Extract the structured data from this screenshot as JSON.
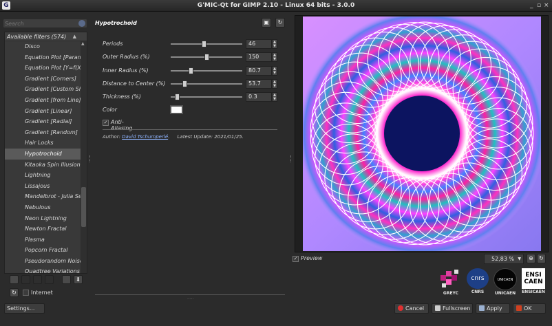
{
  "window": {
    "title": "G'MIC-Qt for GIMP 2.10 - Linux 64 bits - 3.0.0",
    "controls": "_ ▫ ×"
  },
  "search": {
    "placeholder": "Search"
  },
  "filters": {
    "header": "Available filters (574)",
    "items": [
      "Disco",
      "Equation Plot [Parametric]",
      "Equation Plot [Y=f(X)]",
      "Gradient [Corners]",
      "Gradient [Custom Shape]",
      "Gradient [from Line]",
      "Gradient [Linear]",
      "Gradient [Radial]",
      "Gradient [Random]",
      "Hair Locks",
      "Hypotrochoid",
      "Kitaoka Spin Illusion",
      "Lightning",
      "Lissajous",
      "Mandelbrot - Julia Sets",
      "Nebulous",
      "Neon Lightning",
      "Newton Fractal",
      "Plasma",
      "Popcorn Fractal",
      "Pseudorandom Noise",
      "Quadtree Variations"
    ],
    "selected_index": 10
  },
  "internet": {
    "label": "Internet",
    "checked": false
  },
  "settings_label": "Settings...",
  "filter": {
    "title": "Hypotrochoid",
    "params": [
      {
        "label": "Periods",
        "value": "46",
        "fraction": 0.46
      },
      {
        "label": "Outer Radius (%)",
        "value": "150",
        "fraction": 0.5
      },
      {
        "label": "Inner Radius (%)",
        "value": "80.7",
        "fraction": 0.27
      },
      {
        "label": "Distance to Center (%)",
        "value": "53.7",
        "fraction": 0.18
      },
      {
        "label": "Thickness (%)",
        "value": "0.3",
        "fraction": 0.06
      }
    ],
    "color_label": "Color",
    "color_value": "#ffffff",
    "antialias_label": "Anti-Aliasing",
    "antialias_checked": true,
    "author_prefix": "Author:",
    "author_name": "David Tschumperlé",
    "author_suffix": ".",
    "update_text": "Latest Update: 2021/01/25."
  },
  "preview": {
    "label": "Preview",
    "checked": true,
    "zoom": "52,83 %",
    "curve_periods": 46
  },
  "logos": [
    {
      "caption": "GREYC",
      "text": ""
    },
    {
      "caption": "CNRS",
      "text": "cnrs"
    },
    {
      "caption": "UNICAEN",
      "text": "UNICAEN"
    },
    {
      "caption": "ENSICAEN",
      "text": "ENSI CAEN"
    }
  ],
  "buttons": {
    "cancel": "Cancel",
    "fullscreen": "Fullscreen",
    "apply": "Apply",
    "ok": "OK"
  },
  "colors": {
    "accent_cancel": "#e03030",
    "accent_ok": "#d04020"
  }
}
